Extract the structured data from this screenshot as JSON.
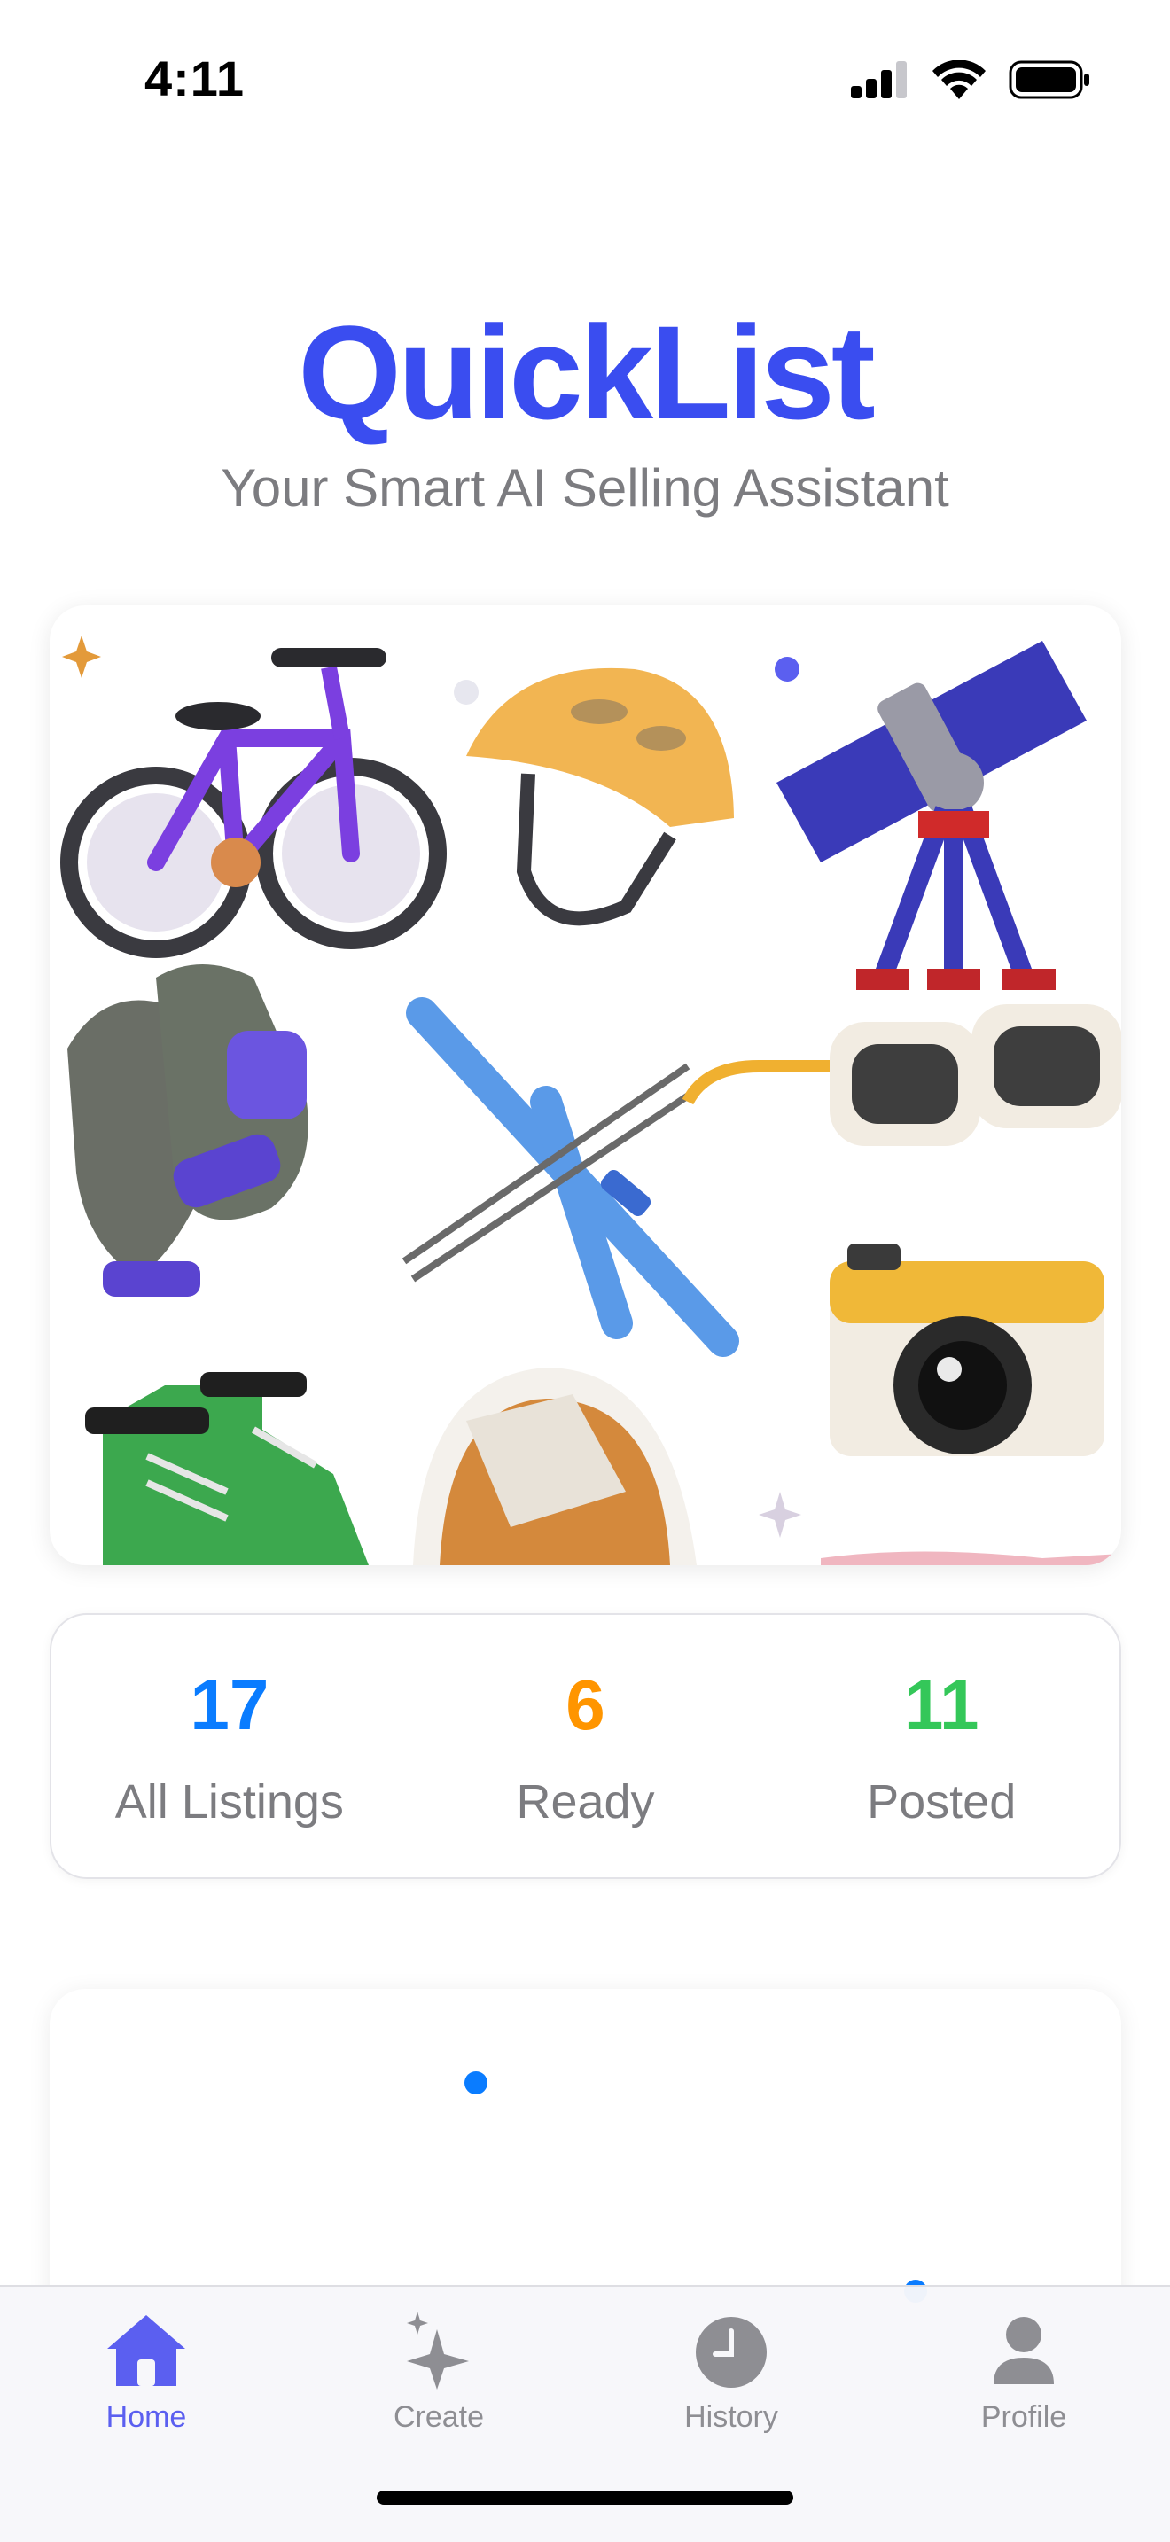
{
  "status_bar": {
    "time": "4:11"
  },
  "header": {
    "title": "QuickList",
    "subtitle": "Your Smart AI Selling Assistant"
  },
  "stats": [
    {
      "value": "17",
      "label": "All Listings",
      "color": "#0a7cff"
    },
    {
      "value": "6",
      "label": "Ready",
      "color": "#ff9500"
    },
    {
      "value": "11",
      "label": "Posted",
      "color": "#34c759"
    }
  ],
  "tabs": [
    {
      "label": "Home",
      "icon": "home-icon",
      "active": true
    },
    {
      "label": "Create",
      "icon": "sparkles-icon",
      "active": false
    },
    {
      "label": "History",
      "icon": "clock-icon",
      "active": false
    },
    {
      "label": "Profile",
      "icon": "person-icon",
      "active": false
    }
  ],
  "colors": {
    "brand": "#3a4df0",
    "active_tab": "#5b5ff0",
    "inactive_tab": "#8e8e93",
    "dot": "#0a7cff"
  }
}
